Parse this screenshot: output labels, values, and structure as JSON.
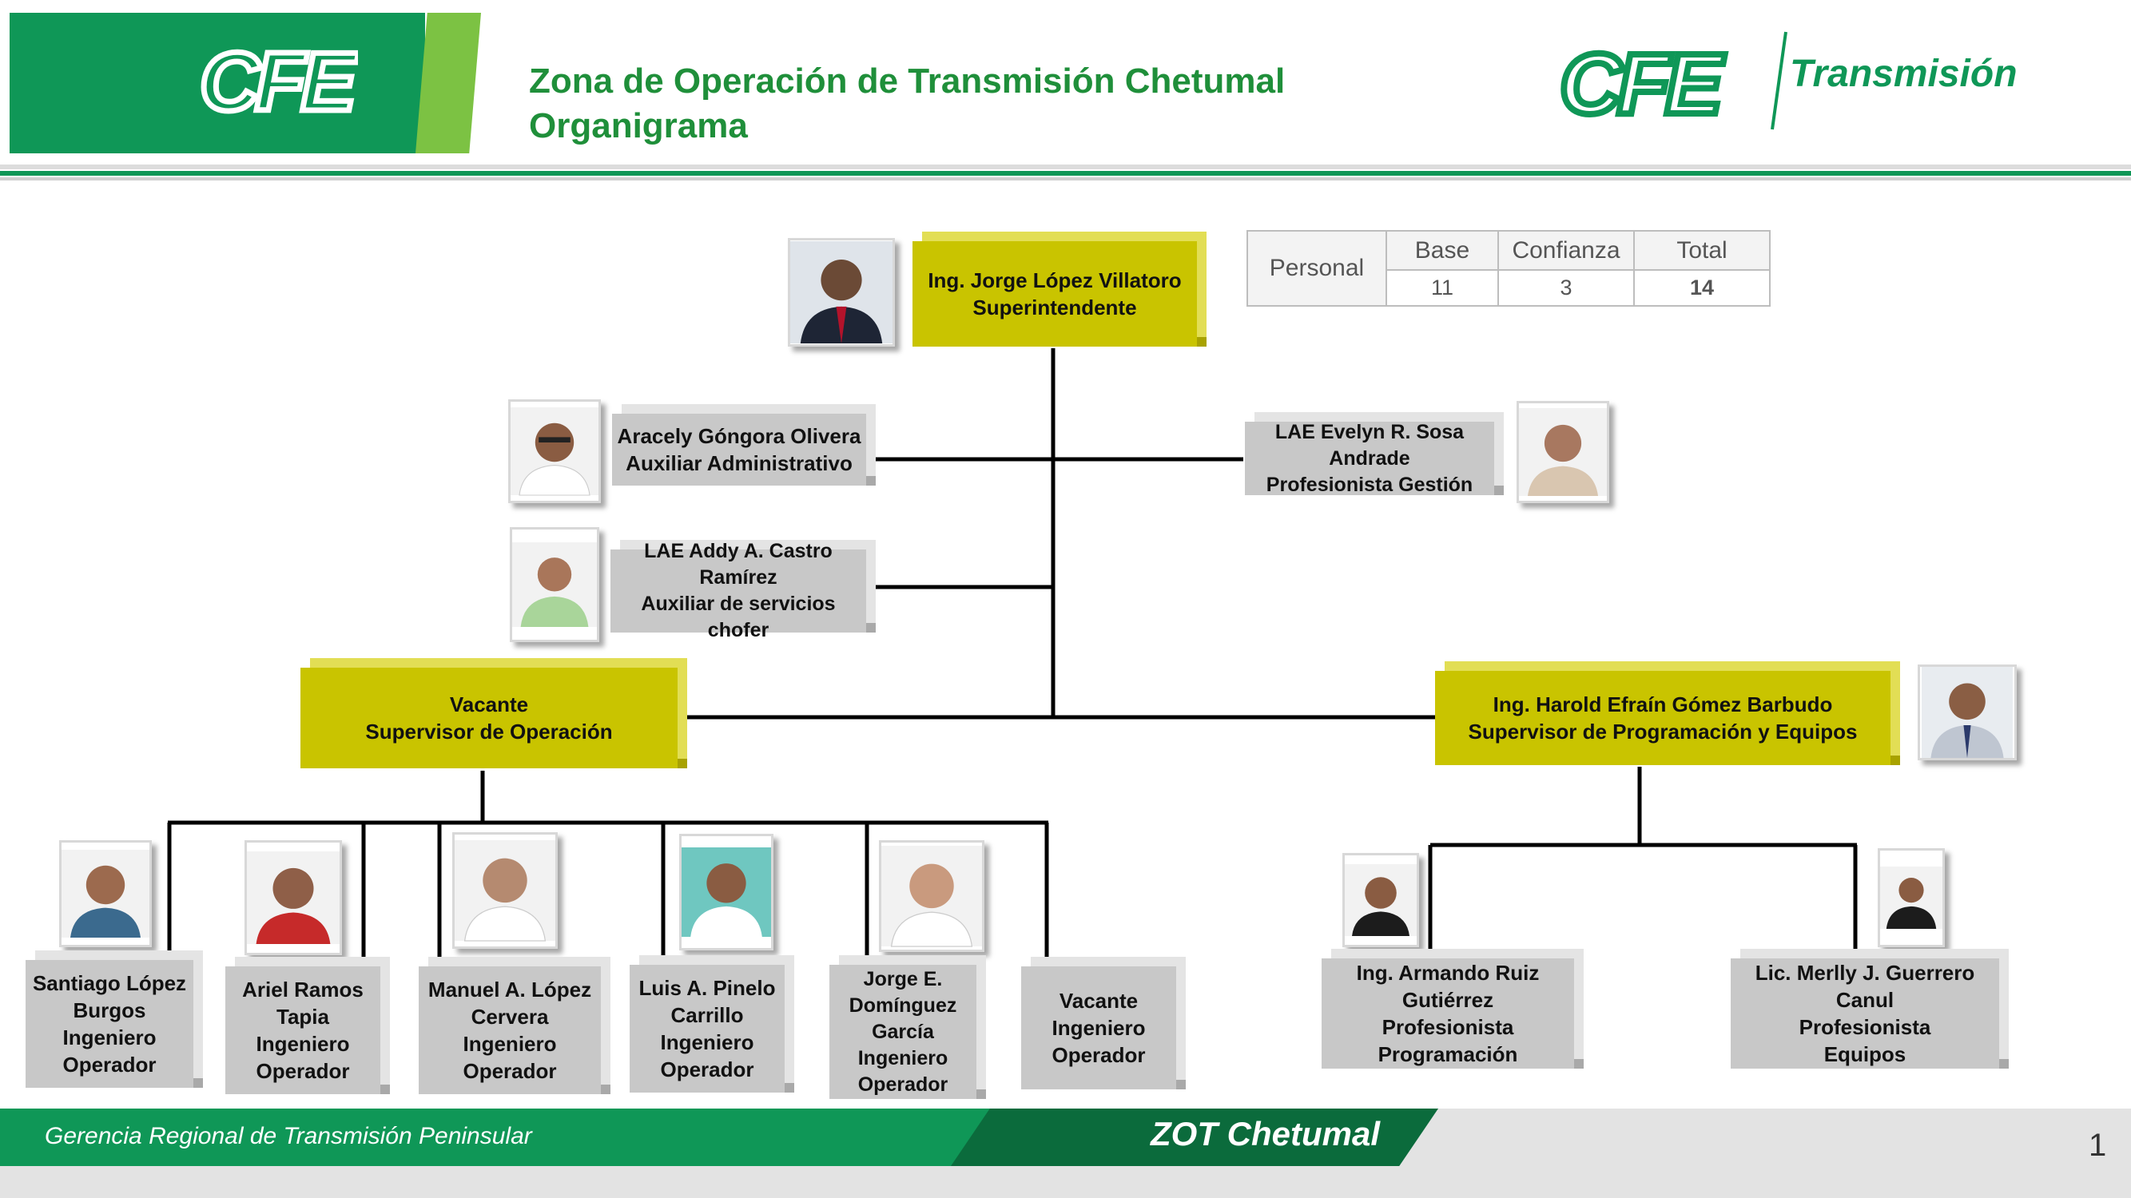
{
  "header": {
    "logo_left": "CFE",
    "title_line1": "Zona de Operación de Transmisión Chetumal",
    "title_line2": "Organigrama",
    "logo_right": "CFE",
    "logo_right_sub": "Transmisión"
  },
  "stats_table": {
    "row_label": "Personal",
    "columns": [
      "Base",
      "Confianza",
      "Total"
    ],
    "values": [
      "11",
      "3",
      "14"
    ]
  },
  "org": {
    "superintendent": {
      "name": "Ing. Jorge López Villatoro",
      "role": "Superintendente"
    },
    "aux_admin": {
      "name": "Aracely Góngora Olivera",
      "role": "Auxiliar  Administrativo"
    },
    "aux_services": {
      "name": "LAE Addy A. Castro Ramírez",
      "role": "Auxiliar de servicios",
      "role2": "chofer"
    },
    "prof_gestion": {
      "name1": "LAE Evelyn R. Sosa",
      "name2": "Andrade",
      "role": "Profesionista Gestión"
    },
    "sup_operacion": {
      "name": "Vacante",
      "role": "Supervisor de Operación"
    },
    "sup_programacion": {
      "name": "Ing. Harold Efraín Gómez Barbudo",
      "role": "Supervisor de Programación  y Equipos"
    },
    "operators": [
      {
        "line1": "Santiago López",
        "line2": "Burgos",
        "line3": "Ingeniero",
        "line4": "Operador"
      },
      {
        "line1": "Ariel Ramos",
        "line2": "Tapia",
        "line3": "Ingeniero",
        "line4": "Operador"
      },
      {
        "line1": "Manuel A. López",
        "line2": "Cervera",
        "line3": "Ingeniero",
        "line4": "Operador"
      },
      {
        "line1": "Luis A. Pinelo",
        "line2": "Carrillo",
        "line3": "Ingeniero",
        "line4": "Operador"
      },
      {
        "line1": "Jorge E.",
        "line2": "Domínguez",
        "line3": "García",
        "line4": "Ingeniero",
        "line5": "Operador"
      },
      {
        "line1": "Vacante",
        "line2": "Ingeniero",
        "line3": "Operador"
      }
    ],
    "prog_team": [
      {
        "line1": "Ing. Armando Ruiz",
        "line2": "Gutiérrez",
        "line3": "Profesionista Programación"
      },
      {
        "line1": "Lic. Merlly J. Guerrero Canul",
        "line2": "Profesionista",
        "line3": "Equipos"
      }
    ]
  },
  "footer": {
    "left_text": "Gerencia Regional de Transmisión Peninsular",
    "center_text": "ZOT Chetumal",
    "page_number": "1"
  },
  "colors": {
    "brand_green": "#0f9757",
    "lime": "#7cc243",
    "box_yellow": "#c9c400",
    "box_gray": "#c8c8c8"
  }
}
